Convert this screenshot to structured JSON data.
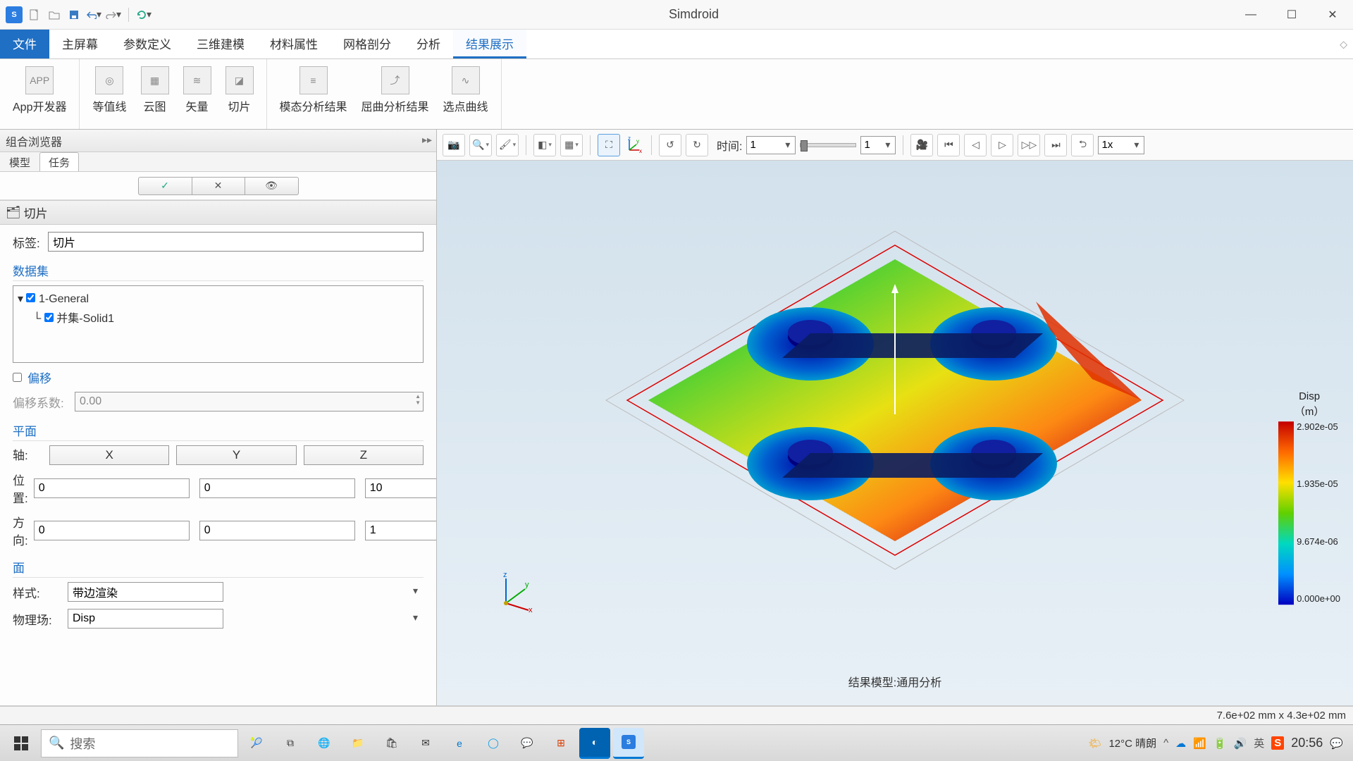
{
  "app": {
    "title": "Simdroid"
  },
  "qat_icons": [
    "new",
    "open",
    "save",
    "undo",
    "redo",
    "refresh"
  ],
  "menu": {
    "file": "文件",
    "items": [
      "主屏幕",
      "参数定义",
      "三维建模",
      "材料属性",
      "网格剖分",
      "分析",
      "结果展示"
    ],
    "active_index": 6
  },
  "ribbon": {
    "groups": [
      {
        "buttons": [
          {
            "label": "App开发器",
            "icon": "app"
          }
        ]
      },
      {
        "buttons": [
          {
            "label": "等值线",
            "icon": "contour"
          },
          {
            "label": "云图",
            "icon": "cloud"
          },
          {
            "label": "矢量",
            "icon": "vector"
          },
          {
            "label": "切片",
            "icon": "slice"
          }
        ]
      },
      {
        "buttons": [
          {
            "label": "模态分析结果",
            "icon": "modal"
          },
          {
            "label": "屈曲分析结果",
            "icon": "buckling"
          },
          {
            "label": "选点曲线",
            "icon": "curve"
          }
        ]
      }
    ]
  },
  "sidebar": {
    "title": "组合浏览器",
    "tabs": [
      "模型",
      "任务"
    ],
    "active_tab": 1,
    "actions": [
      "check",
      "close",
      "eye"
    ],
    "section_title": "切片",
    "label_field": {
      "label": "标签:",
      "value": "切片"
    },
    "dataset": {
      "header": "数据集",
      "root": "1-General",
      "child": "并集-Solid1"
    },
    "offset": {
      "label": "偏移",
      "coef_label": "偏移系数:",
      "value": "0.00",
      "checked": false
    },
    "plane": {
      "header": "平面",
      "axis_label": "轴:",
      "axes": [
        "X",
        "Y",
        "Z"
      ],
      "position_label": "位置:",
      "position": [
        "0",
        "0",
        "10"
      ],
      "direction_label": "方向:",
      "direction": [
        "0",
        "0",
        "1"
      ]
    },
    "face": {
      "header": "面",
      "style_label": "样式:",
      "style_value": "带边渲染",
      "field_label": "物理场:",
      "field_value": "Disp"
    }
  },
  "vp_toolbar": {
    "time_label": "时间:",
    "time_value": "1",
    "frame_value": "1",
    "speed": "1x"
  },
  "viewport": {
    "caption": "结果模型:通用分析",
    "colorbar": {
      "title": "Disp",
      "unit": "（m）",
      "ticks": [
        "2.902e-05",
        "1.935e-05",
        "9.674e-06",
        "0.000e+00"
      ]
    }
  },
  "status": {
    "coords": "7.6e+02 mm x 4.3e+02 mm"
  },
  "taskbar": {
    "search_placeholder": "搜索",
    "weather": "12°C 晴朗",
    "ime": "英",
    "clock": "20:56"
  }
}
